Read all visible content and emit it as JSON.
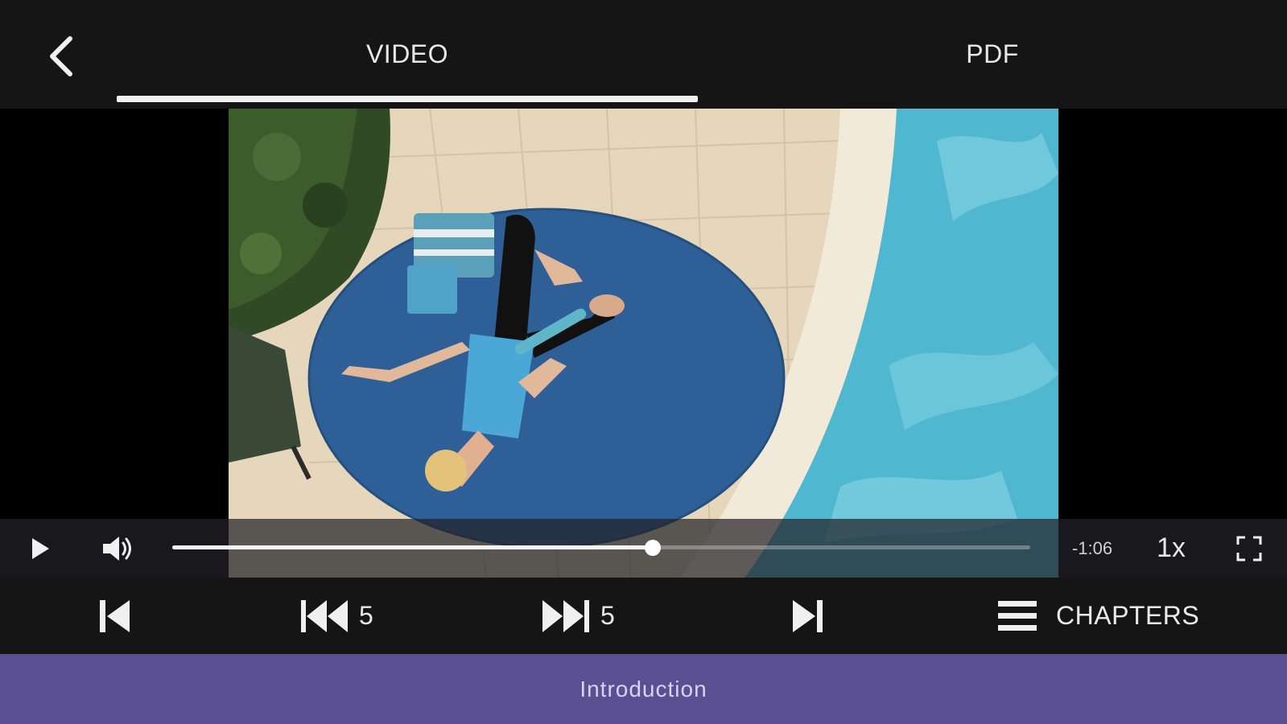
{
  "header": {
    "tabs": [
      {
        "label": "VIDEO",
        "active": true
      },
      {
        "label": "PDF",
        "active": false
      }
    ]
  },
  "player": {
    "progress_fraction": 0.56,
    "time_remaining": "-1:06",
    "speed": "1x"
  },
  "transport": {
    "skip_back_seconds": "5",
    "skip_forward_seconds": "5",
    "chapters_label": "CHAPTERS"
  },
  "chapter": {
    "current": "Introduction"
  },
  "colors": {
    "accent": "#5a4f91",
    "bar_background": "#151515"
  },
  "icons": [
    "back-chevron-icon",
    "play-icon",
    "volume-icon",
    "fullscreen-icon",
    "skip-previous-icon",
    "rewind-icon",
    "fast-forward-icon",
    "skip-next-icon",
    "hamburger-menu-icon"
  ]
}
